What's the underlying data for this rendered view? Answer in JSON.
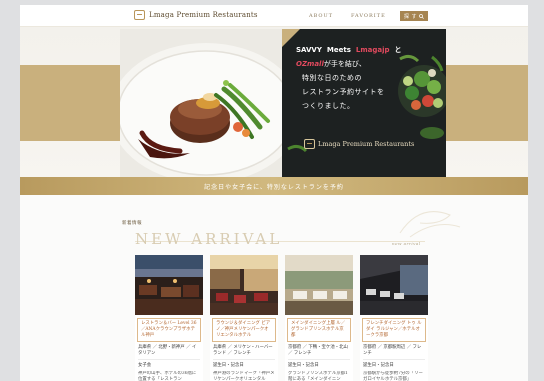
{
  "header": {
    "logo_text": "Lmaga Premium Restaurants",
    "nav": [
      "ABOUT",
      "FAVORITE"
    ],
    "search_label": "探 す"
  },
  "hero": {
    "brands": [
      "SAVVY",
      "Meets",
      "Lmagajp"
    ],
    "brand_tail": "と",
    "oz_brand": "OZmall",
    "oz_tail": "が手を結び、",
    "lines": [
      "特別な日のための",
      "レストラン予約サイトを",
      "つくりました。"
    ],
    "panel_logo_text": "Lmaga Premium Restaurants",
    "banner": "記念日や女子会に、特別なレストランを予約"
  },
  "new_arrival": {
    "label": "新着情報",
    "title": "NEW ARRIVAL",
    "subtitle": "new arrival",
    "cards": [
      {
        "name": "レストラン＆バー Level 36／ANAクラウンプラザホテル神戸",
        "tags": "兵庫県 ／ 北野・新神戸 ／ イタリアン",
        "occasion": "女子会",
        "desc": "神戸の山手、ホテルの36階に位置する「レストラン"
      },
      {
        "name": "ラウンジ＆ダイニング ピアノ／神戸メリケンパークオリエンタルホテル",
        "tags": "兵庫県 ／ メリケン・ハーバーランド ／ フレンチ",
        "occasion": "誕生日・記念日",
        "desc": "神戸港のランドマーク「神戸メリケンパークオリエンタル"
      },
      {
        "name": "メインダイニング上層 ル／グランドプリンスホテル京都",
        "tags": "京都府 ／ 下鴨・宝ケ池・北山 ／ フレンチ",
        "occasion": "誕生日・記念日",
        "desc": "グランドプリンスホテル京都1階にある「メインダイニン"
      },
      {
        "name": "フレンチダイニング トゥ ル ダイ ラルジャン／ホテルオークラ京都",
        "tags": "京都府 ／ 京都駅周辺 ／ フレンチ",
        "occasion": "誕生日・記念日",
        "desc": "京都駅から徒歩約7分の「リーガロイヤルホテル京都」"
      }
    ]
  },
  "colors": {
    "gold": "#c9b07d",
    "gold_dark": "#a68552",
    "card_title": "#b2652e",
    "dark_panel": "#1d2121"
  }
}
